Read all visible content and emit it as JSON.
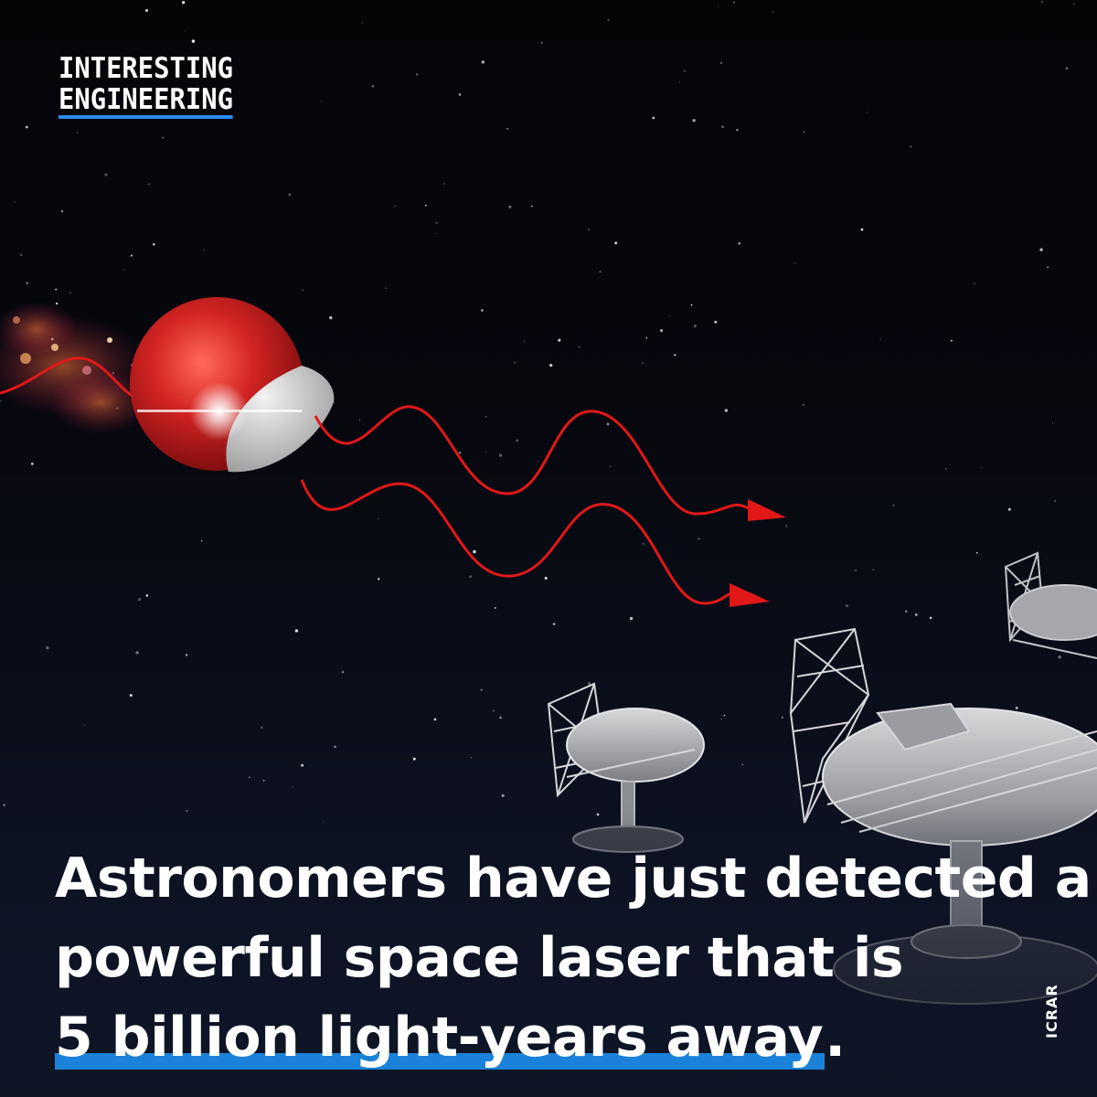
{
  "brand": {
    "line1": "INTERESTING",
    "line2": "ENGINEERING",
    "accent_color": "#2a8cf0"
  },
  "headline": {
    "line1": "Astronomers have just detected a",
    "line2": "powerful space laser that is",
    "line3_highlight": "5 billion light-years away",
    "line3_end": ".",
    "highlight_color": "#1a82d8"
  },
  "credit": "ICRAR",
  "illustration": {
    "subject": "megamaser galaxy emitting radio waves toward radio telescopes",
    "sphere_color": "#d42424",
    "wave_color": "#e01818",
    "icons": [
      "galaxy-sphere-icon",
      "radio-wave-arrow-icon",
      "radio-telescope-icon"
    ]
  }
}
